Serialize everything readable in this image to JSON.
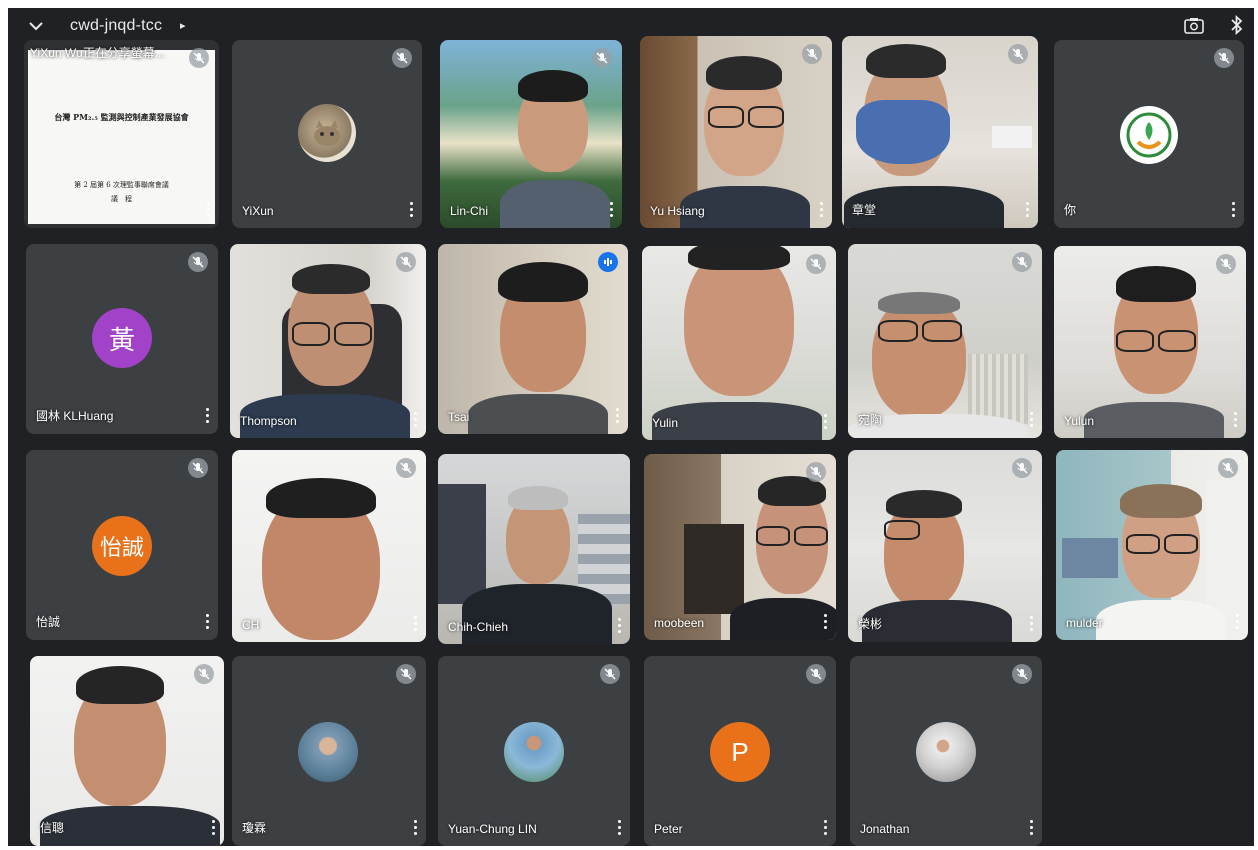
{
  "meeting": {
    "code": "cwd-jnqd-tcc",
    "caret": "▸"
  },
  "icons": {
    "collapse": "chevron-down-icon",
    "camera": "switch-camera-icon",
    "bluetooth": "bluetooth-icon",
    "mic_off": "mic-off-icon",
    "more": "more-vert-icon",
    "speaking": "audio-level-icon"
  },
  "presentation": {
    "banner": "YiXun Wu正在分享螢幕...",
    "doc_title": "台灣 PM₂.₅ 監測與控制產業發展協會",
    "doc_subtitle": "第 2 屆第 6 次理監事聯席會議",
    "doc_note": "議　程"
  },
  "tiles": [
    {
      "name": "YiXun",
      "avatar_kind": "photo-cat"
    },
    {
      "name": "Lin-Chi"
    },
    {
      "name": "Yu Hsiang"
    },
    {
      "name": "章堂"
    },
    {
      "name": "你",
      "avatar_kind": "logo"
    },
    {
      "name": "國林 KLHuang",
      "avatar_letter": "黃",
      "avatar_color": "#a142c9"
    },
    {
      "name": "Thompson"
    },
    {
      "name": "Tsai",
      "speaking": true
    },
    {
      "name": "Yulin"
    },
    {
      "name": "宛陶"
    },
    {
      "name": "Yulun"
    },
    {
      "name": "怡誠",
      "avatar_letter": "怡誠",
      "avatar_color": "#e8711a"
    },
    {
      "name": "CH"
    },
    {
      "name": "Chih-Chieh"
    },
    {
      "name": "moobeen"
    },
    {
      "name": "榮彬"
    },
    {
      "name": "mulder"
    },
    {
      "name": "信聰"
    },
    {
      "name": "瓊霖",
      "avatar_kind": "photo"
    },
    {
      "name": "Yuan-Chung LIN",
      "avatar_kind": "photo"
    },
    {
      "name": "Peter",
      "avatar_letter": "P",
      "avatar_color": "#e8711a"
    },
    {
      "name": "Jonathan",
      "avatar_kind": "photo"
    }
  ],
  "colors": {
    "bg": "#202124",
    "tile": "#3c4043",
    "speaking": "#1a73e8"
  }
}
